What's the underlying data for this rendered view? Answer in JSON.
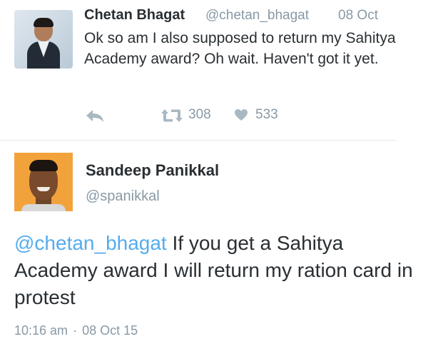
{
  "tweet1": {
    "name": "Chetan Bhagat",
    "handle": "@chetan_bhagat",
    "date": "08 Oct",
    "text": "Ok so am I also supposed to return my Sahitya Academy award? Oh wait. Haven't got it yet.",
    "retweets": "308",
    "likes": "533"
  },
  "tweet2": {
    "name": "Sandeep Panikkal",
    "handle": "@spanikkal",
    "mention": "@chetan_bhagat",
    "text": " If you get a Sahitya Academy award I will return my ration card in protest",
    "time": "10:16 am",
    "separator": "·",
    "date": "08 Oct 15"
  },
  "colors": {
    "accent": "#55acee",
    "muted": "#8899a6",
    "text": "#292f33",
    "divider": "#e1e8ed"
  },
  "icons": {
    "reply": "reply-icon",
    "retweet": "retweet-icon",
    "like": "heart-icon"
  }
}
